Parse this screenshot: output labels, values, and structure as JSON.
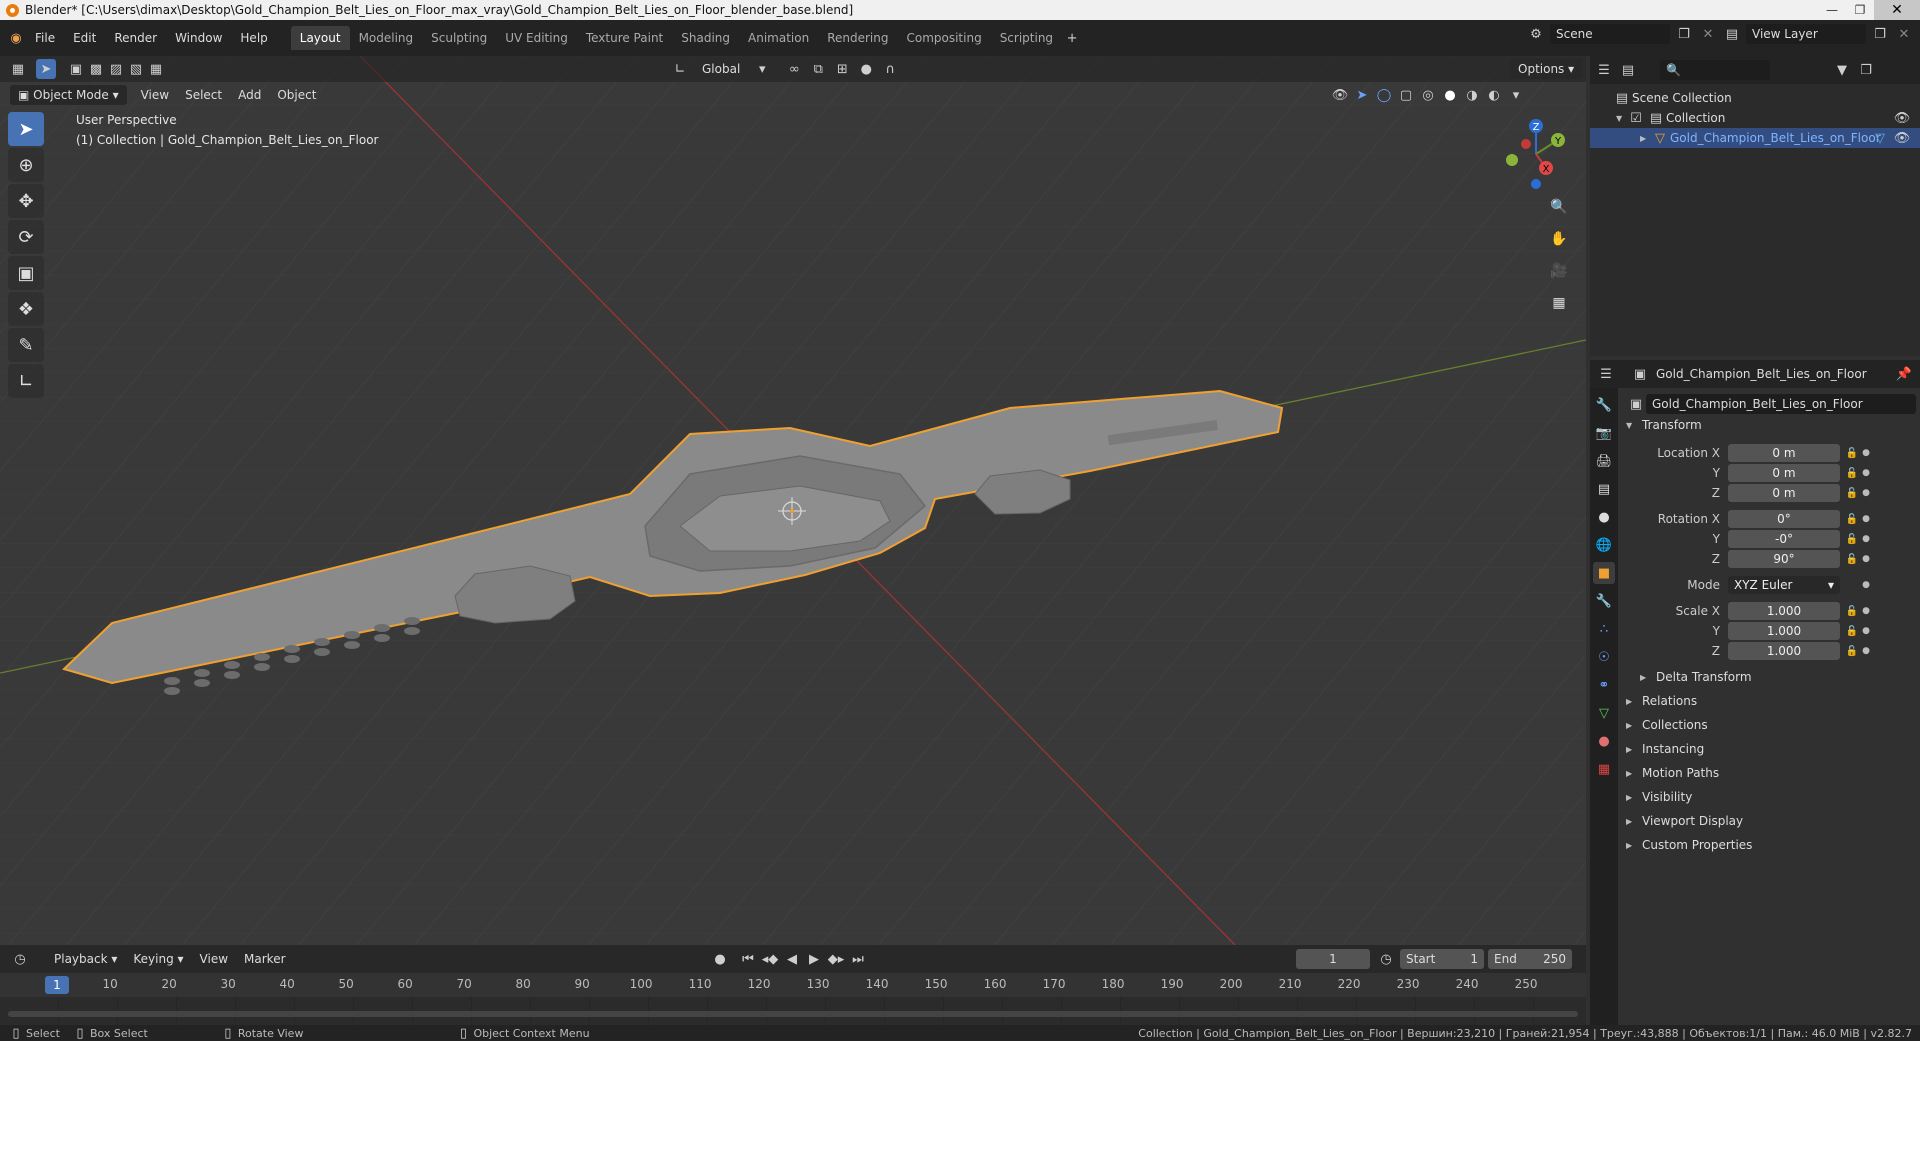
{
  "title_bar": {
    "text": "Blender* [C:\\Users\\dimax\\Desktop\\Gold_Champion_Belt_Lies_on_Floor_max_vray\\Gold_Champion_Belt_Lies_on_Floor_blender_base.blend]"
  },
  "menu": [
    "File",
    "Edit",
    "Render",
    "Window",
    "Help"
  ],
  "workspaces": [
    "Layout",
    "Modeling",
    "Sculpting",
    "UV Editing",
    "Texture Paint",
    "Shading",
    "Animation",
    "Rendering",
    "Compositing",
    "Scripting"
  ],
  "scene": {
    "label": "Scene",
    "view_layer": "View Layer"
  },
  "viewport": {
    "mode": "Object Mode",
    "menus": [
      "View",
      "Select",
      "Add",
      "Object"
    ],
    "transform_orientation": "Global",
    "options_label": "Options",
    "perspective_label": "User Perspective",
    "collection_label": "(1) Collection | Gold_Champion_Belt_Lies_on_Floor",
    "gizmo": {
      "x": "X",
      "y": "Y",
      "z": "Z"
    }
  },
  "timeline": {
    "menus": [
      "Playback",
      "Keying",
      "View",
      "Marker"
    ],
    "current_frame": "1",
    "start_label": "Start",
    "start": "1",
    "end_label": "End",
    "end": "250",
    "ticks": [
      "10",
      "20",
      "30",
      "40",
      "50",
      "60",
      "70",
      "80",
      "90",
      "100",
      "110",
      "120",
      "130",
      "140",
      "150",
      "160",
      "170",
      "180",
      "190",
      "200",
      "210",
      "220",
      "230",
      "240",
      "250"
    ]
  },
  "statusbar": {
    "select": "Select",
    "box_select": "Box Select",
    "rotate_view": "Rotate View",
    "context_menu": "Object Context Menu",
    "stats": "Collection | Gold_Champion_Belt_Lies_on_Floor | Вершин:23,210 | Граней:21,954 | Треуг.:43,888 | Объектов:1/1 | Пам.: 46.0 MiB | v2.82.7"
  },
  "outliner": {
    "scene_collection": "Scene Collection",
    "collection": "Collection",
    "object": "Gold_Champion_Belt_Lies_on_Floor"
  },
  "properties": {
    "header_object": "Gold_Champion_Belt_Lies_on_Floor",
    "object_name": "Gold_Champion_Belt_Lies_on_Floor",
    "transform_label": "Transform",
    "location": {
      "label_x": "Location X",
      "label_y": "Y",
      "label_z": "Z",
      "x": "0 m",
      "y": "0 m",
      "z": "0 m"
    },
    "rotation": {
      "label_x": "Rotation X",
      "label_y": "Y",
      "label_z": "Z",
      "x": "0°",
      "y": "-0°",
      "z": "90°"
    },
    "mode": {
      "label": "Mode",
      "value": "XYZ Euler"
    },
    "scale": {
      "label_x": "Scale X",
      "label_y": "Y",
      "label_z": "Z",
      "x": "1.000",
      "y": "1.000",
      "z": "1.000"
    },
    "delta_transform": "Delta Transform",
    "panels": [
      "Relations",
      "Collections",
      "Instancing",
      "Motion Paths",
      "Visibility",
      "Viewport Display",
      "Custom Properties"
    ]
  },
  "colors": {
    "accent": "#4772b3",
    "selection_outline": "#f0a030",
    "x_axis": "#c23b3b",
    "y_axis": "#6a8f2a",
    "z_axis": "#2b6fd6"
  }
}
